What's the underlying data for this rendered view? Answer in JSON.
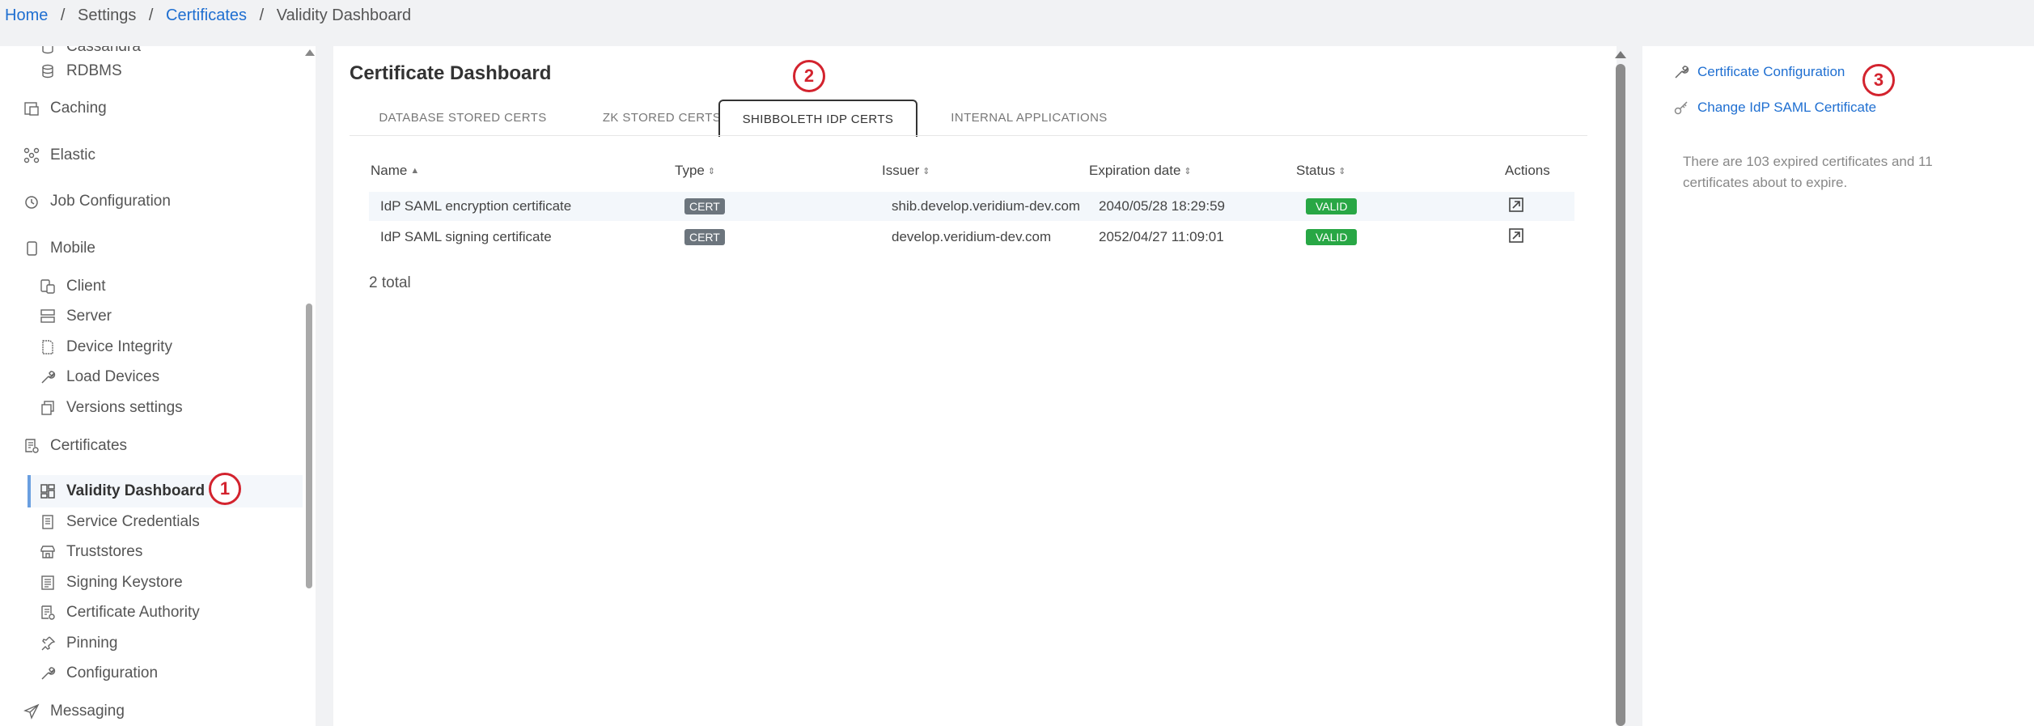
{
  "breadcrumb": {
    "home": "Home",
    "settings": "Settings",
    "certificates": "Certificates",
    "current": "Validity Dashboard",
    "sep": "/"
  },
  "sidebar": {
    "items": [
      {
        "label": "Cassandra",
        "icon": "database-icon",
        "level": "sub"
      },
      {
        "label": "RDBMS",
        "icon": "database-icon",
        "level": "sub"
      },
      {
        "label": "Caching",
        "icon": "caching-icon",
        "level": "top"
      },
      {
        "label": "Elastic",
        "icon": "elastic-icon",
        "level": "top"
      },
      {
        "label": "Job Configuration",
        "icon": "clock-icon",
        "level": "top"
      },
      {
        "label": "Mobile",
        "icon": "mobile-icon",
        "level": "top"
      },
      {
        "label": "Client",
        "icon": "client-icon",
        "level": "sub"
      },
      {
        "label": "Server",
        "icon": "server-icon",
        "level": "sub"
      },
      {
        "label": "Device Integrity",
        "icon": "document-icon",
        "level": "sub"
      },
      {
        "label": "Load Devices",
        "icon": "wrench-icon",
        "level": "sub"
      },
      {
        "label": "Versions settings",
        "icon": "versions-icon",
        "level": "sub"
      },
      {
        "label": "Certificates",
        "icon": "certificate-icon",
        "level": "top"
      },
      {
        "label": "Validity Dashboard",
        "icon": "dashboard-icon",
        "level": "sub",
        "active": true
      },
      {
        "label": "Service Credentials",
        "icon": "document-icon",
        "level": "sub"
      },
      {
        "label": "Truststores",
        "icon": "store-icon",
        "level": "sub"
      },
      {
        "label": "Signing Keystore",
        "icon": "list-icon",
        "level": "sub"
      },
      {
        "label": "Certificate Authority",
        "icon": "certificate-icon",
        "level": "sub"
      },
      {
        "label": "Pinning",
        "icon": "pin-icon",
        "level": "sub"
      },
      {
        "label": "Configuration",
        "icon": "wrench-icon",
        "level": "sub"
      },
      {
        "label": "Messaging",
        "icon": "send-icon",
        "level": "top"
      }
    ]
  },
  "main": {
    "title": "Certificate Dashboard",
    "tabs": [
      {
        "label": "DATABASE STORED CERTS"
      },
      {
        "label": "ZK STORED CERTS"
      },
      {
        "label": "SHIBBOLETH IDP CERTS",
        "active": true
      },
      {
        "label": "INTERNAL APPLICATIONS"
      }
    ],
    "table": {
      "columns": [
        "Name",
        "Type",
        "Issuer",
        "Expiration date",
        "Status",
        "Actions"
      ],
      "rows": [
        {
          "name": "IdP SAML encryption certificate",
          "type": "CERT",
          "issuer": "shib.develop.veridium-dev.com",
          "expiration": "2040/05/28 18:29:59",
          "status": "VALID"
        },
        {
          "name": "IdP SAML signing certificate",
          "type": "CERT",
          "issuer": "develop.veridium-dev.com",
          "expiration": "2052/04/27 11:09:01",
          "status": "VALID"
        }
      ],
      "total": "2 total"
    }
  },
  "right_panel": {
    "links": [
      {
        "label": "Certificate Configuration",
        "icon": "wrench-icon"
      },
      {
        "label": "Change IdP SAML Certificate",
        "icon": "key-icon"
      }
    ],
    "note": "There are 103 expired certificates and 11 certificates about to expire."
  },
  "annotations": [
    "1",
    "2",
    "3"
  ],
  "colors": {
    "link": "#1f6fd1",
    "valid": "#28a745",
    "cert_badge": "#6c757d",
    "annotation": "#d3232e",
    "active_bar": "#6a9fe0"
  }
}
